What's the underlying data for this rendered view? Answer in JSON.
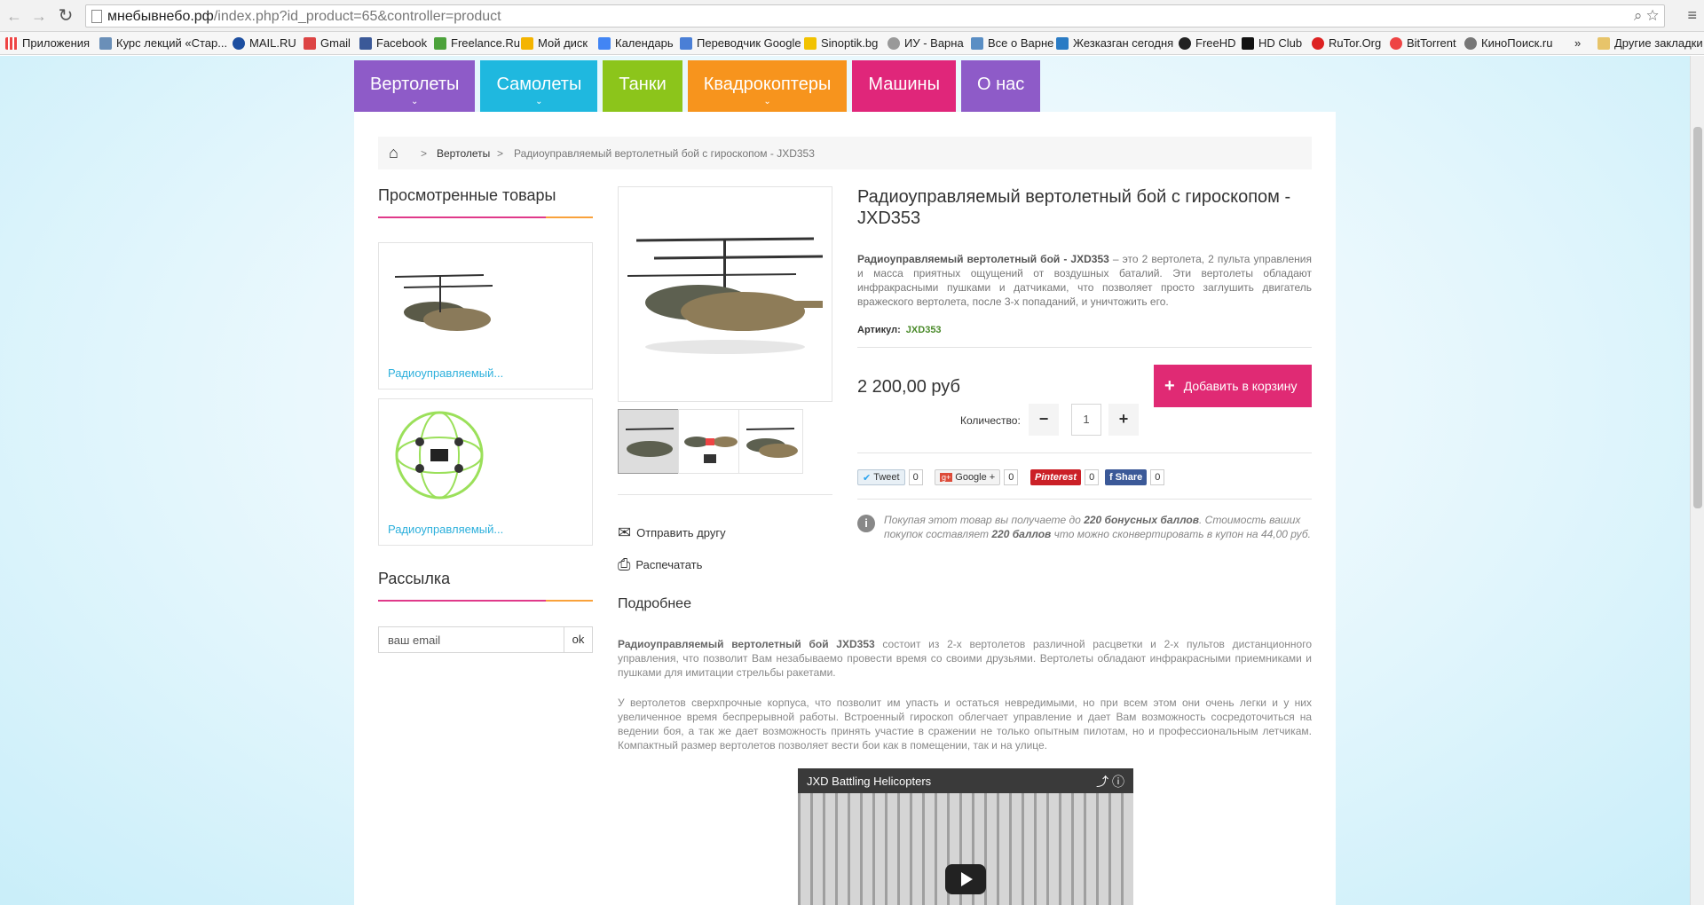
{
  "browser": {
    "url_host": "мнебывнебо.рф",
    "url_path": "/index.php?id_product=65&controller=product",
    "bookmarks": [
      "Приложения",
      "Курс лекций «Стар...",
      "MAIL.RU",
      "Gmail",
      "Facebook",
      "Freelance.Ru",
      "Мой диск",
      "Календарь",
      "Переводчик Google",
      "Sinoptik.bg",
      "ИУ - Варна",
      "Все о Варне",
      "Жезказган сегодня",
      "FreeHD",
      "HD Club",
      "RuTor.Org",
      "BitTorrent",
      "КиноПоиск.ru"
    ],
    "more_bookmarks": "»",
    "other_bookmarks": "Другие закладки"
  },
  "nav": [
    {
      "label": "Вертолеты",
      "color": "#8e5bc8",
      "has_dropdown": true
    },
    {
      "label": "Самолеты",
      "color": "#1fb8df",
      "has_dropdown": true
    },
    {
      "label": "Танки",
      "color": "#8cc51b",
      "has_dropdown": false
    },
    {
      "label": "Квадрокоптеры",
      "color": "#f7941d",
      "has_dropdown": true
    },
    {
      "label": "Машины",
      "color": "#e0267a",
      "has_dropdown": false
    },
    {
      "label": "О нас",
      "color": "#8e5bc8",
      "has_dropdown": false
    }
  ],
  "breadcrumb": {
    "sep": ">",
    "category": "Вертолеты",
    "current": "Радиоуправляемый вертолетный бой с гироскопом - JXD353"
  },
  "viewed": {
    "title": "Просмотренные товары",
    "items": [
      {
        "label": "Радиоуправляемый..."
      },
      {
        "label": "Радиоуправляемый..."
      }
    ]
  },
  "newsletter": {
    "title": "Рассылка",
    "placeholder": "ваш email",
    "button": "ok"
  },
  "product": {
    "title": "Радиоуправляемый вертолетный бой с гироскопом - JXD353",
    "desc_bold": "Радиоуправляемый вертолетный бой - JXD353",
    "desc_rest": " – это 2 вертолета, 2 пульта управления и масса приятных ощущений от воздушных баталий. Эти вертолеты обладают инфракрасными пушками и датчиками, что позволяет просто заглушить двигатель вражеского вертолета, после 3-х попаданий, и уничтожить его.",
    "sku_label": "Артикул:",
    "sku": "JXD353",
    "price": "2 200,00 руб",
    "add_to_cart": "Добавить в корзину",
    "qty_label": "Количество:",
    "qty": "1",
    "minus": "−",
    "plus": "+",
    "send_friend": "Отправить другу",
    "print": "Распечатать"
  },
  "social": [
    {
      "label": "Tweet",
      "count": "0",
      "color": "#e8f0f6",
      "text_color": "#333"
    },
    {
      "label": "Google +",
      "count": "0",
      "color": "#f3f3f3",
      "text_color": "#333"
    },
    {
      "label": "Pinterest",
      "count": "0",
      "color": "#cb2027",
      "text_color": "#fff"
    },
    {
      "label": "Share",
      "count": "0",
      "color": "#3b5998",
      "text_color": "#fff"
    }
  ],
  "bonus": {
    "p1": "Покупая этот товар вы получаете до ",
    "b1": "220 бонусных баллов",
    "p2": ". Стоимость ваших покупок составляет ",
    "b2": "220 баллов",
    "p3": " что можно сконвертировать в купон на 44,00 руб."
  },
  "details": {
    "title": "Подробнее",
    "para1_bold": "Радиоуправляемый вертолетный бой JXD353",
    "para1_rest": " состоит из 2-х вертолетов различной расцветки и 2-х пультов дистанционного управления, что позволит Вам незабываемо провести время со своими друзьями. Вертолеты обладают инфракрасными приемниками и пушками для имитации стрельбы ракетами.",
    "para2": "У вертолетов сверхпрочные корпуса, что позволит им упасть и остаться невредимыми, но при всем этом они очень легки и у них увеличенное время беспрерывной работы. Встроенный гироскоп облегчает управление и дает Вам возможность сосредоточиться на ведении боя, а так же дает возможность принять участие в сражении не только опытным пилотам, но и профессиональным летчикам. Компактный размер вертолетов позволяет вести бои как в помещении, так и на улице."
  },
  "video": {
    "title": "JXD Battling Helicopters"
  }
}
